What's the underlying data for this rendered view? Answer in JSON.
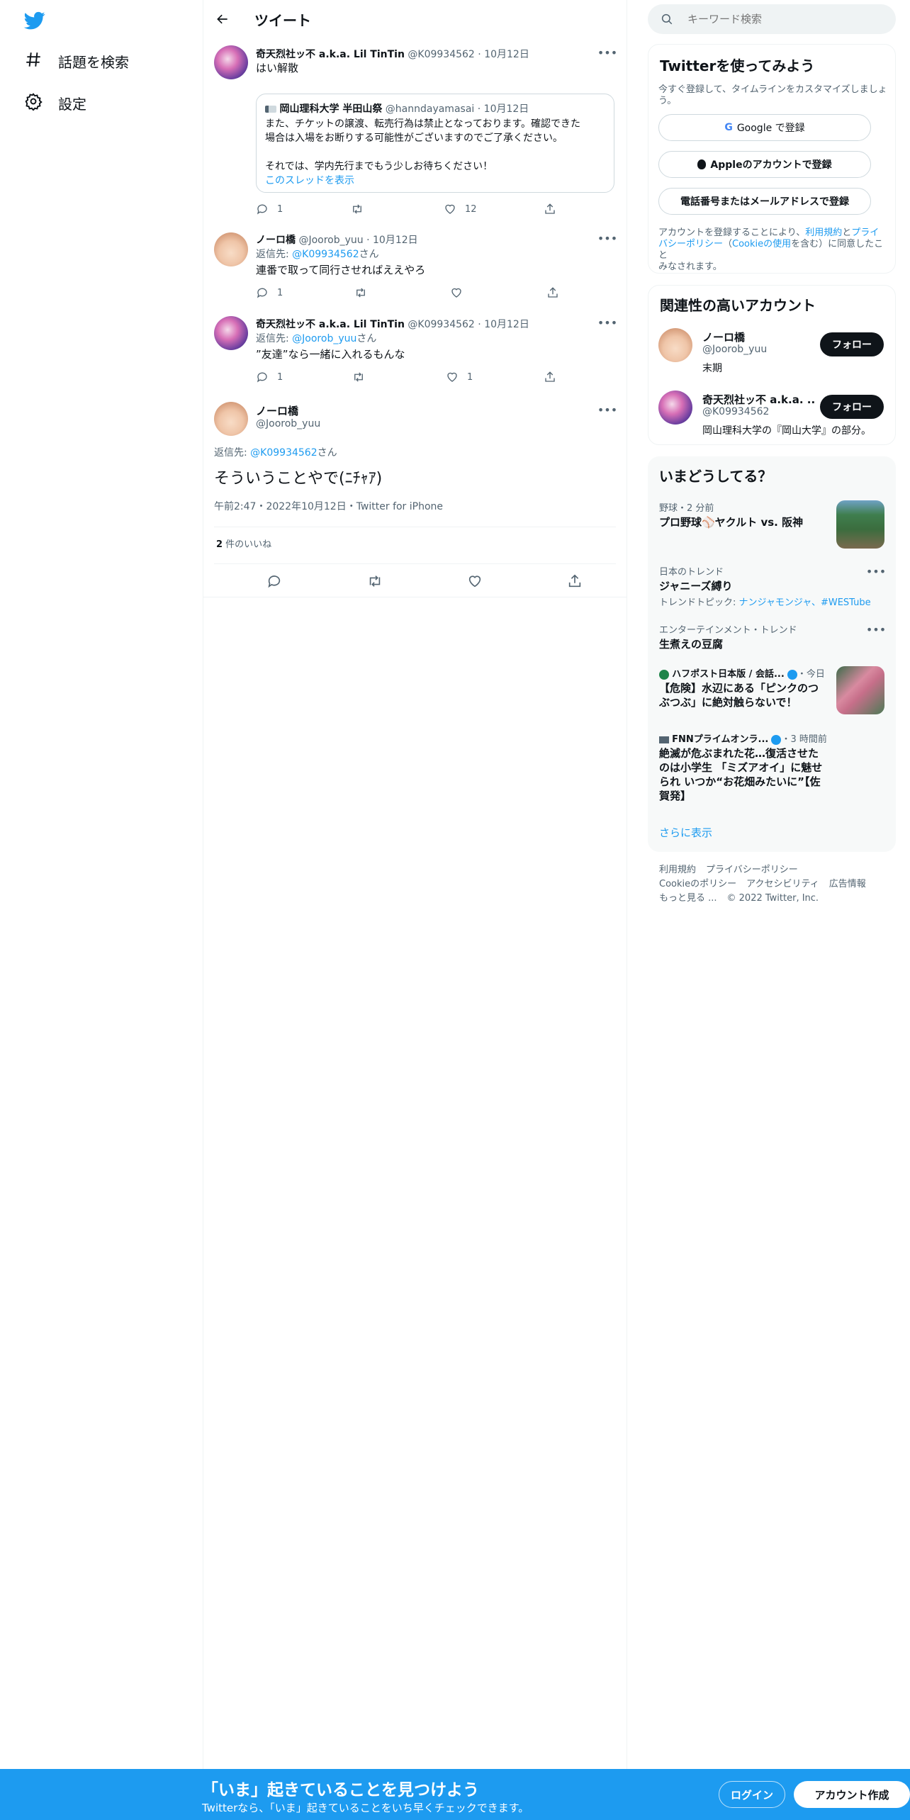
{
  "nav": {
    "items": [
      {
        "label": "話題を検索",
        "icon": "hashtag-icon"
      },
      {
        "label": "設定",
        "icon": "gear-icon"
      }
    ]
  },
  "header": {
    "title": "ツイート"
  },
  "tweets": [
    {
      "name": "奇天烈社ッ不 a.k.a. Lil TinTin",
      "handle": "@K09934562",
      "date": "10月12日",
      "text": "はい解散",
      "quote": {
        "name": "岡山理科大学 半田山祭",
        "handle": "@hanndayamasai",
        "date": "10月12日",
        "line1": "また、チケットの譲渡、転売行為は禁止となっております。確認できた",
        "line2": "場合は入場をお断りする可能性がございますのでご了承ください。",
        "line3": "それでは、学内先行までもう少しお待ちください！",
        "thread": "このスレッドを表示"
      },
      "reply_count": "1",
      "retweet_count": "",
      "like_count": "12"
    },
    {
      "name": "ノーロ橋",
      "handle": "@Joorob_yuu",
      "date": "10月12日",
      "reply_prefix": "返信先: ",
      "reply_to": "@K09934562",
      "reply_suffix": "さん",
      "text": "連番で取って同行させればええやろ",
      "reply_count": "1",
      "retweet_count": "",
      "like_count": ""
    },
    {
      "name": "奇天烈社ッ不 a.k.a. Lil TinTin",
      "handle": "@K09934562",
      "date": "10月12日",
      "reply_prefix": "返信先: ",
      "reply_to": "@Joorob_yuu",
      "reply_suffix": "さん",
      "text": "”友達”なら一緒に入れるもんな",
      "reply_count": "1",
      "retweet_count": "",
      "like_count": "1"
    }
  ],
  "main_tweet": {
    "name": "ノーロ橋",
    "handle": "@Joorob_yuu",
    "reply_prefix": "返信先: ",
    "reply_to": "@K09934562",
    "reply_suffix": "さん",
    "text": "そういうことやで(ﾆﾁｬｱ)",
    "meta": "午前2:47・2022年10月12日・Twitter for iPhone",
    "likes_num": "2",
    "likes_label": " 件のいいね"
  },
  "search": {
    "placeholder": "キーワード検索"
  },
  "signup_card": {
    "title": "Twitterを使ってみよう",
    "subtitle_1": "今すぐ登録して、タイムラインをカスタマイズしましょ",
    "subtitle_2": "う。",
    "google": "Google で登録",
    "apple": "Appleのアカウントで登録",
    "phone": "電話番号またはメールアドレスで登録",
    "terms_1a": "アカウントを登録することにより、",
    "terms_1b": "利用規約",
    "terms_1c": "と",
    "terms_1d": "プライ",
    "terms_2a": "バシーポリシー",
    "terms_2b": "（",
    "terms_2c": "Cookieの使用",
    "terms_2d": "を含む）に同意したこと",
    "terms_3": "みなされます。"
  },
  "related": {
    "title": "関連性の高いアカウント",
    "accounts": [
      {
        "name": "ノーロ橋",
        "handle": "@Joorob_yuu",
        "bio": "末期",
        "follow": "フォロー"
      },
      {
        "name": "奇天烈社ッ不 a.k.a. ...",
        "handle": "@K09934562",
        "bio": "岡山理科大学の『岡山大学』の部分。",
        "follow": "フォロー"
      }
    ]
  },
  "trends": {
    "title": "いまどうしてる？",
    "items": [
      {
        "meta": "野球・2 分前",
        "name": "プロ野球⚾ヤクルト vs. 阪神"
      },
      {
        "meta": "日本のトレンド",
        "name": "ジャニーズ縛り",
        "topics_prefix": "トレンドトピック: ",
        "topics": "ナンジャモンジャ、#WESTube"
      },
      {
        "meta": "エンターテインメント・トレンド",
        "name": "生煮えの豆腐"
      },
      {
        "meta_source": "ハフポスト日本版 / 会話...",
        "meta_time": "・今日",
        "name_1": "【危険】水辺にある「ピンクのつ",
        "name_2": "ぶつぶ」に絶対触らないで！"
      },
      {
        "meta_source": "FNNプライムオンラ...",
        "meta_time": "・3 時間前",
        "name_1": "絶滅が危ぶまれた花…復活させた",
        "name_2": "のは小学生 「ミズアオイ」に魅せ",
        "name_3": "られ いつか“お花畑みたいに”【佐",
        "name_4": "賀発】"
      }
    ],
    "show_more": "さらに表示"
  },
  "footer": {
    "terms": "利用規約",
    "privacy": "プライバシーポリシー",
    "cookie": "Cookieのポリシー",
    "accessibility": "アクセシビリティ",
    "ads": "広告情報",
    "more": "もっと見る ...",
    "copyright": "© 2022 Twitter, Inc."
  },
  "bottom_bar": {
    "title": "「いま」起きていることを見つけよう",
    "subtitle": "Twitterなら、「いま」起きていることをいち早くチェックできます。",
    "login": "ログイン",
    "signup": "アカウント作成"
  },
  "colors": {
    "accent": "#1d9bf0",
    "text": "#0f1419",
    "muted": "#536471",
    "border": "#eff3f4"
  }
}
